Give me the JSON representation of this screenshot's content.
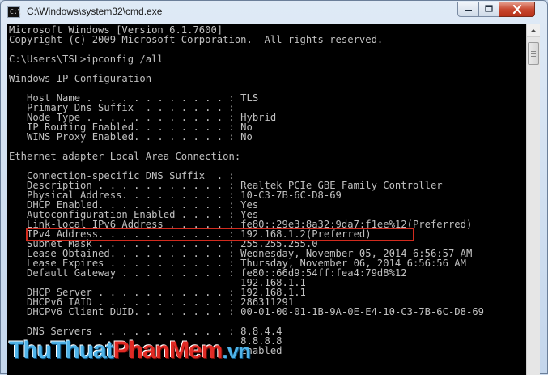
{
  "window": {
    "title": "C:\\Windows\\system32\\cmd.exe",
    "icon": "cmd-icon"
  },
  "console": {
    "text": "Microsoft Windows [Version 6.1.7600]\nCopyright (c) 2009 Microsoft Corporation.  All rights reserved.\n\nC:\\Users\\TSL>ipconfig /all\n\nWindows IP Configuration\n\n   Host Name . . . . . . . . . . . . : TLS\n   Primary Dns Suffix  . . . . . . . :\n   Node Type . . . . . . . . . . . . : Hybrid\n   IP Routing Enabled. . . . . . . . : No\n   WINS Proxy Enabled. . . . . . . . : No\n\nEthernet adapter Local Area Connection:\n\n   Connection-specific DNS Suffix  . :\n   Description . . . . . . . . . . . : Realtek PCIe GBE Family Controller\n   Physical Address. . . . . . . . . : 10-C3-7B-6C-D8-69\n   DHCP Enabled. . . . . . . . . . . : Yes\n   Autoconfiguration Enabled . . . . : Yes\n   Link-local IPv6 Address . . . . . : fe80::29e3:8a32:9da7:f1ee%12(Preferred)\n   IPv4 Address. . . . . . . . . . . : 192.168.1.2(Preferred)\n   Subnet Mask . . . . . . . . . . . : 255.255.255.0\n   Lease Obtained. . . . . . . . . . : Wednesday, November 05, 2014 6:56:57 AM\n   Lease Expires . . . . . . . . . . : Thursday, November 06, 2014 6:56:56 AM\n   Default Gateway . . . . . . . . . : fe80::66d9:54ff:fea4:79d8%12\n                                       192.168.1.1\n   DHCP Server . . . . . . . . . . . : 192.168.1.1\n   DHCPv6 IAID . . . . . . . . . . . : 286311291\n   DHCPv6 Client DUID. . . . . . . . : 00-01-00-01-1B-9A-0E-E4-10-C3-7B-6C-D8-69\n\n   DNS Servers . . . . . . . . . . . : 8.8.4.4\n                                       8.8.8.8\n                                     : Enabled"
  },
  "watermark": {
    "part1": "Thu",
    "part2": "Thuat",
    "part3": "PhanMem",
    "part4": ".vn"
  },
  "colors": {
    "console_bg": "#000000",
    "console_fg": "#c0c0c0",
    "highlight": "#d22b1e"
  }
}
